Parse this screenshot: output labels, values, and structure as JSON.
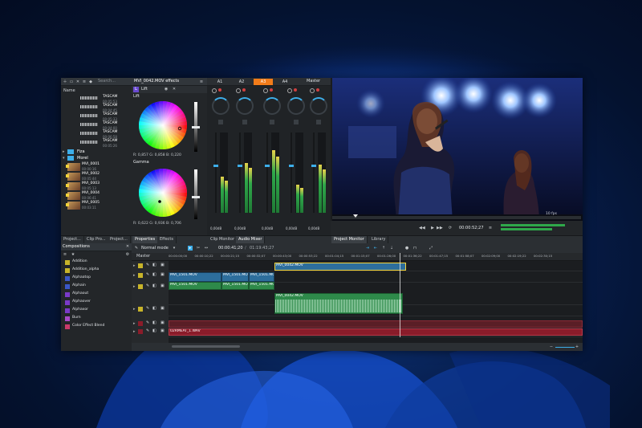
{
  "project_bin": {
    "header": "Name",
    "search_placeholder": "Search...",
    "audio_clips": [
      {
        "name": "TASCAM",
        "duration": "00:05:53"
      },
      {
        "name": "TASCAM",
        "duration": "00:04:45"
      },
      {
        "name": "TASCAM",
        "duration": "00:05:33"
      },
      {
        "name": "TASCAM",
        "duration": "00:04:00"
      },
      {
        "name": "TASCAM",
        "duration": "00:06:58"
      },
      {
        "name": "TASCAM",
        "duration": "00:05:26"
      }
    ],
    "folders": [
      "Fiza",
      "Morel"
    ],
    "video_clips": [
      {
        "name": "MVI_0001",
        "duration": "00:00:16"
      },
      {
        "name": "MVI_0002",
        "duration": "00:05:44"
      },
      {
        "name": "MVI_0003",
        "duration": "00:05:13"
      },
      {
        "name": "MVI_0004",
        "duration": "00:06:41"
      },
      {
        "name": "MVI_0005",
        "duration": "00:03:11"
      }
    ]
  },
  "effects": {
    "title": "MVI_0042.MOV effects",
    "effect_name": "Lift",
    "section_lift": "Lift",
    "section_gamma": "Gamma",
    "lift_values": "R: 0,857   G: 0,858   B: 0,220",
    "gamma_values": "R: 0,622   G: 0,936   B: 0,706"
  },
  "mixer": {
    "channels": [
      "A1",
      "A2",
      "A3",
      "A4"
    ],
    "active_channel": "A3",
    "master_label": "Master",
    "readouts": [
      "0,00dB",
      "0,00dB",
      "0,00dB",
      "0,00dB",
      "0,00dB"
    ],
    "levels": [
      0.45,
      0.62,
      0.78,
      0.35,
      0.6
    ]
  },
  "monitor": {
    "timecode": "00:00:52;27",
    "zoom_label": "10 fps",
    "tabs": [
      "Clip Monitor",
      "Audio Mixer",
      "Project Monitor",
      "Library"
    ],
    "active_tab": "Project Monitor"
  },
  "left_tabs": [
    "Project...",
    "Clip Pro...",
    "Project..."
  ],
  "middle_tabs": [
    "Properties",
    "Effects"
  ],
  "compositions": {
    "title": "Compositions",
    "items": [
      {
        "label": "Addition",
        "color": "#c8b42a"
      },
      {
        "label": "Addition_alpha",
        "color": "#c8b42a"
      },
      {
        "label": "Alphaatop",
        "color": "#3a57c8"
      },
      {
        "label": "Alphain",
        "color": "#3a57c8"
      },
      {
        "label": "Alphaout",
        "color": "#7a3ac8"
      },
      {
        "label": "Alphaover",
        "color": "#7a3ac8"
      },
      {
        "label": "Alphaxor",
        "color": "#7a3ac8"
      },
      {
        "label": "Burn",
        "color": "#a84ac8"
      },
      {
        "label": "Color Effect Blend",
        "color": "#c83a6a"
      }
    ]
  },
  "timeline": {
    "mode": "Normal mode",
    "position": "00:00:41;20",
    "duration": "01:19:43;27",
    "master_label": "Master",
    "ruler": [
      "00:00:00;00",
      "00:00:10;22",
      "00:00:21;15",
      "00:00:32;07",
      "00:00:43;00",
      "00:00:53;22",
      "00:01:04;15",
      "00:01:15;07",
      "00:01:26;00",
      "00:01:36;22",
      "00:01:47;15",
      "00:01:58;07",
      "00:02:09;00",
      "00:02:19;22",
      "00:02:30;15"
    ],
    "v1_clips": [
      "MVI_0042.MOV"
    ],
    "v2_clips": [
      "MVI_1501.MOV",
      "MVI_1501.MOV",
      "MVI_1501.MOV"
    ],
    "a1_clips": [
      "MVI_1501.MOV",
      "MVI_1501.MOV",
      "MVI_1501.MOV"
    ],
    "a2_clip": "MVI_0042.MOV",
    "a3_clip": "02RMEAT_1.WAV"
  },
  "colors": {
    "accent": "#f27c1a",
    "selection": "#3daee9",
    "audio": "#2e8a4a",
    "video": "#2d6e9c",
    "red_track": "#8a1c2a"
  }
}
